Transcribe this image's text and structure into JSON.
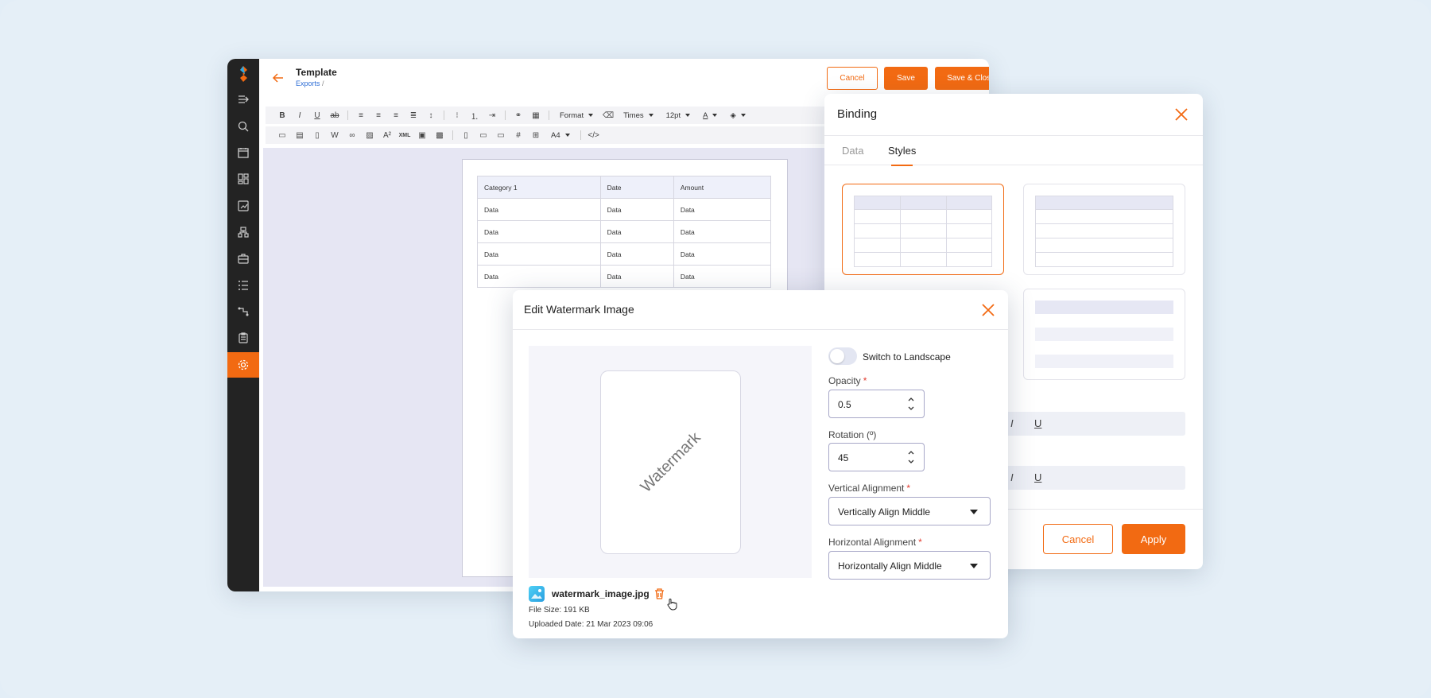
{
  "editor": {
    "title": "Template",
    "breadcrumb": "Exports",
    "breadcrumb_sep": "/",
    "cancel_label": "Cancel",
    "save_label": "Save",
    "save_close_label": "Save & Close",
    "toolbar": {
      "format": "Format",
      "font": "Times",
      "size": "12pt",
      "page_size": "A4"
    },
    "table": {
      "headers": [
        "Category 1",
        "Date",
        "Amount"
      ],
      "rows": [
        [
          "Data",
          "Data",
          "Data"
        ],
        [
          "Data",
          "Data",
          "Data"
        ],
        [
          "Data",
          "Data",
          "Data"
        ],
        [
          "Data",
          "Data",
          "Data"
        ]
      ]
    }
  },
  "sidebar": {
    "icons": [
      "expand-icon",
      "search-icon",
      "calendar-icon",
      "dashboard-icon",
      "reports-icon",
      "org-chart-icon",
      "briefcase-icon",
      "list-icon",
      "connection-icon",
      "clipboard-icon",
      "settings-icon"
    ],
    "active": "settings-icon"
  },
  "binding": {
    "title": "Binding",
    "tabs": [
      "Data",
      "Styles"
    ],
    "active_tab": "Styles",
    "cancel_label": "Cancel",
    "apply_label": "Apply",
    "italic": "I",
    "underline": "U"
  },
  "watermark": {
    "title": "Edit Watermark Image",
    "preview_text": "Watermark",
    "landscape_label": "Switch to Landscape",
    "landscape_on": false,
    "opacity_label": "Opacity",
    "opacity_value": "0.5",
    "rotation_label": "Rotation (º)",
    "rotation_value": "45",
    "vertical_label": "Vertical Alignment",
    "vertical_value": "Vertically Align Middle",
    "horizontal_label": "Horizontal Alignment",
    "horizontal_value": "Horizontally Align Middle",
    "file_name": "watermark_image.jpg",
    "file_size": "File Size: 191 KB",
    "uploaded": "Uploaded Date: 21 Mar 2023 09:06",
    "required_mark": "*"
  },
  "colors": {
    "accent": "#f26a12",
    "sidebar": "#232323",
    "link": "#2f6fd6"
  }
}
